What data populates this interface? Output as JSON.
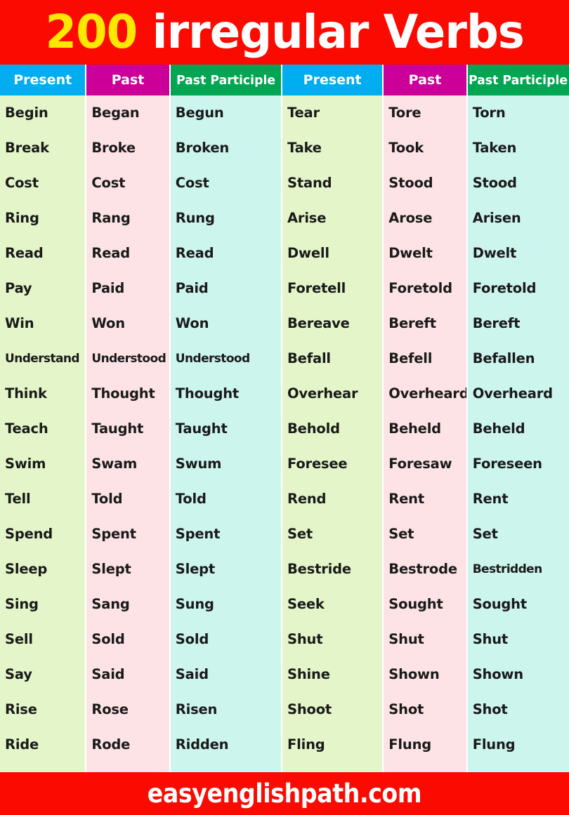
{
  "title": {
    "count": "200",
    "rest": " irregular Verbs",
    "full": "200 irregular Verbs",
    "banner_color": "#fa0a00",
    "count_color": "#ffe800",
    "text_color": "#ffffff"
  },
  "footer": {
    "text": "easyenglishpath.com",
    "banner_color": "#fa0a00",
    "text_color": "#ffffff"
  },
  "colors": {
    "header_present": "#00aeef",
    "header_past": "#cc0099",
    "header_past_participle": "#00a651",
    "cell_present": "#e4f6c9",
    "cell_past": "#fde3e6",
    "cell_past_participle": "#ccf5ee",
    "cell_text": "#1a1a1a"
  },
  "headers": {
    "present": "Present",
    "past": "Past",
    "past_participle": "Past Participle"
  },
  "left_table": {
    "columns": [
      "Present",
      "Past",
      "Past Participle"
    ],
    "rows": [
      [
        "Begin",
        "Began",
        "Begun"
      ],
      [
        "Break",
        "Broke",
        "Broken"
      ],
      [
        "Cost",
        "Cost",
        "Cost"
      ],
      [
        "Ring",
        "Rang",
        "Rung"
      ],
      [
        "Read",
        "Read",
        "Read"
      ],
      [
        "Pay",
        "Paid",
        "Paid"
      ],
      [
        "Win",
        "Won",
        "Won"
      ],
      [
        "Understand",
        "Understood",
        "Understood"
      ],
      [
        "Think",
        "Thought",
        "Thought"
      ],
      [
        "Teach",
        "Taught",
        "Taught"
      ],
      [
        "Swim",
        "Swam",
        "Swum"
      ],
      [
        "Tell",
        "Told",
        "Told"
      ],
      [
        "Spend",
        "Spent",
        "Spent"
      ],
      [
        "Sleep",
        "Slept",
        "Slept"
      ],
      [
        "Sing",
        "Sang",
        "Sung"
      ],
      [
        "Sell",
        "Sold",
        "Sold"
      ],
      [
        "Say",
        "Said",
        "Said"
      ],
      [
        "Rise",
        "Rose",
        "Risen"
      ],
      [
        "Ride",
        "Rode",
        "Ridden"
      ]
    ]
  },
  "right_table": {
    "columns": [
      "Present",
      "Past",
      "Past Participle"
    ],
    "rows": [
      [
        "Tear",
        "Tore",
        "Torn"
      ],
      [
        "Take",
        "Took",
        "Taken"
      ],
      [
        "Stand",
        "Stood",
        "Stood"
      ],
      [
        "Arise",
        "Arose",
        "Arisen"
      ],
      [
        "Dwell",
        "Dwelt",
        "Dwelt"
      ],
      [
        "Foretell",
        "Foretold",
        "Foretold"
      ],
      [
        "Bereave",
        "Bereft",
        "Bereft"
      ],
      [
        "Befall",
        "Befell",
        "Befallen"
      ],
      [
        "Overhear",
        "Overheard",
        "Overheard"
      ],
      [
        "Behold",
        "Beheld",
        "Beheld"
      ],
      [
        "Foresee",
        "Foresaw",
        "Foreseen"
      ],
      [
        "Rend",
        "Rent",
        "Rent"
      ],
      [
        "Set",
        "Set",
        "Set"
      ],
      [
        "Bestride",
        "Bestrode",
        "Bestridden"
      ],
      [
        "Seek",
        "Sought",
        "Sought"
      ],
      [
        "Shut",
        "Shut",
        "Shut"
      ],
      [
        "Shine",
        "Shown",
        "Shown"
      ],
      [
        "Shoot",
        "Shot",
        "Shot"
      ],
      [
        "Fling",
        "Flung",
        "Flung"
      ]
    ]
  }
}
